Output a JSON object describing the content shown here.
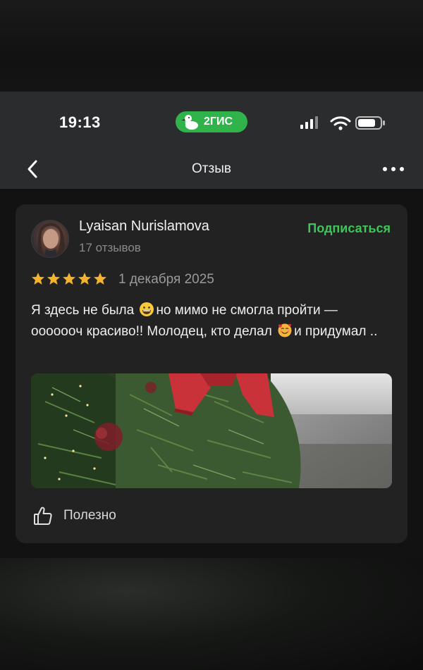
{
  "status_bar": {
    "time": "19:13",
    "brand_label": "2ГИС",
    "brand_color": "#2fb34a",
    "icons": [
      "cellular-signal-icon",
      "wifi-icon",
      "battery-icon"
    ]
  },
  "nav": {
    "back_icon": "chevron-left-icon",
    "title": "Отзыв",
    "more_icon": "more-horizontal-icon"
  },
  "review": {
    "author": "Lyaisan Nurislamova",
    "reviews_count": "17 отзывов",
    "subscribe_label": "Подписаться",
    "accent_color": "#3fc45a",
    "rating": 5,
    "rating_max": 5,
    "date": "1 декабря 2025",
    "text_part1": "Я здесь не была ",
    "emoji1": "grinning-face-emoji",
    "text_part2": "но мимо не смогла пройти — ooooooч красиво!! Молодец, кто делал ",
    "emoji2": "smiling-face-with-hearts-emoji",
    "text_part3": "и придумал ..",
    "photo": "christmas-tree-with-red-bow-photo",
    "helpful_label": "Полезно",
    "helpful_icon": "thumbs-up-icon"
  }
}
